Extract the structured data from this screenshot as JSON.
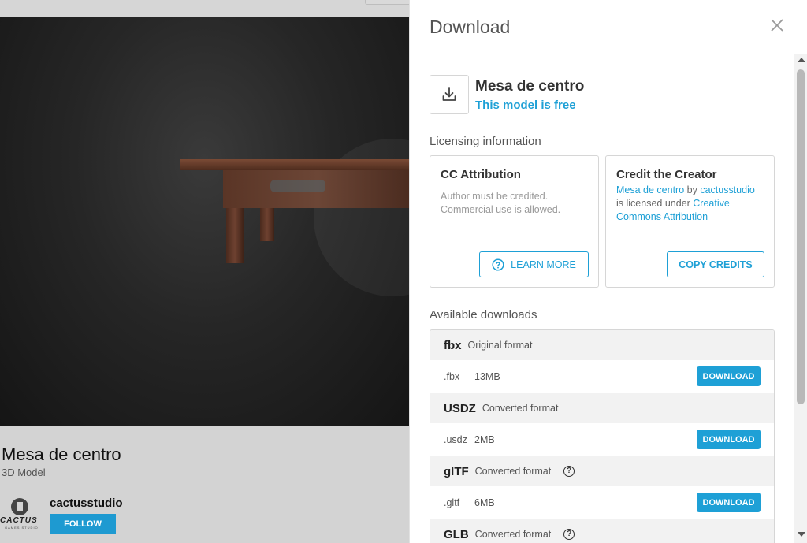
{
  "background_page": {
    "model_title": "Mesa de centro",
    "model_subtitle": "3D Model",
    "author": {
      "name": "cactusstudio",
      "logo_text": "CACTUS",
      "logo_subtext": "GAMES STUDIO",
      "follow_label": "FOLLOW"
    }
  },
  "modal": {
    "title": "Download",
    "close_icon": "close-icon",
    "model_name": "Mesa de centro",
    "price_status": "This model is free",
    "licensing": {
      "section_title": "Licensing information",
      "license_card": {
        "title": "CC Attribution",
        "line1": "Author must be credited.",
        "line2": "Commercial use is allowed.",
        "button_label": "LEARN MORE"
      },
      "credit_card": {
        "title": "Credit the Creator",
        "model_link": "Mesa de centro",
        "by_text": " by ",
        "author_link": "cactusstudio",
        "licensed_text": "is licensed under ",
        "license_link_1": "Creative",
        "license_link_2": "Commons Attribution",
        "button_label": "COPY CREDITS"
      }
    },
    "downloads": {
      "section_title": "Available downloads",
      "button_label": "DOWNLOAD",
      "formats": [
        {
          "name": "fbx",
          "type": "Original format",
          "ext": ".fbx",
          "size": "13MB"
        },
        {
          "name": "USDZ",
          "type": "Converted format",
          "ext": ".usdz",
          "size": "2MB"
        },
        {
          "name": "glTF",
          "type": "Converted format",
          "ext": ".gltf",
          "size": "6MB"
        },
        {
          "name": "GLB",
          "type": "Converted format"
        }
      ]
    }
  },
  "colors": {
    "accent": "#1ea0d6",
    "follow": "#1e9ad1",
    "text_dark": "#333333",
    "muted": "#999999"
  }
}
